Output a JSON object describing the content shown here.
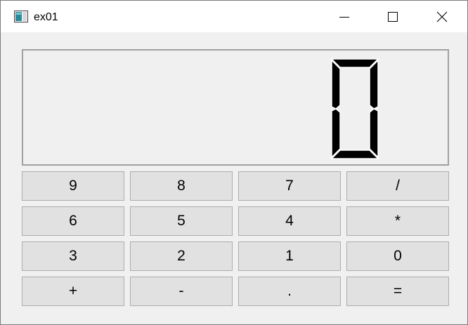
{
  "window": {
    "title": "ex01"
  },
  "display": {
    "value": "0"
  },
  "keys": [
    [
      "9",
      "8",
      "7",
      "/"
    ],
    [
      "6",
      "5",
      "4",
      "*"
    ],
    [
      "3",
      "2",
      "1",
      "0"
    ],
    [
      "+",
      "-",
      ".",
      "="
    ]
  ],
  "icons": {
    "app": "app-window-icon",
    "minimize": "minimize-icon",
    "maximize": "maximize-icon",
    "close": "close-icon"
  }
}
